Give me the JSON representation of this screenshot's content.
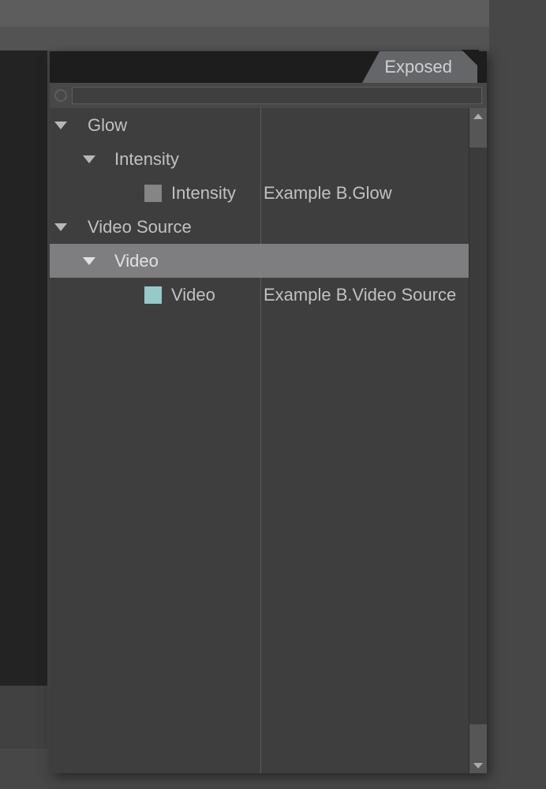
{
  "tab": {
    "label": "Exposed"
  },
  "search": {
    "value": ""
  },
  "tree": {
    "glow": {
      "label": "Glow",
      "intensity_group": "Intensity",
      "intensity_item": "Intensity",
      "intensity_path": "Example B.Glow"
    },
    "videoSource": {
      "label": "Video Source",
      "video_group": "Video",
      "video_item": "Video",
      "video_path": "Example B.Video Source"
    }
  }
}
